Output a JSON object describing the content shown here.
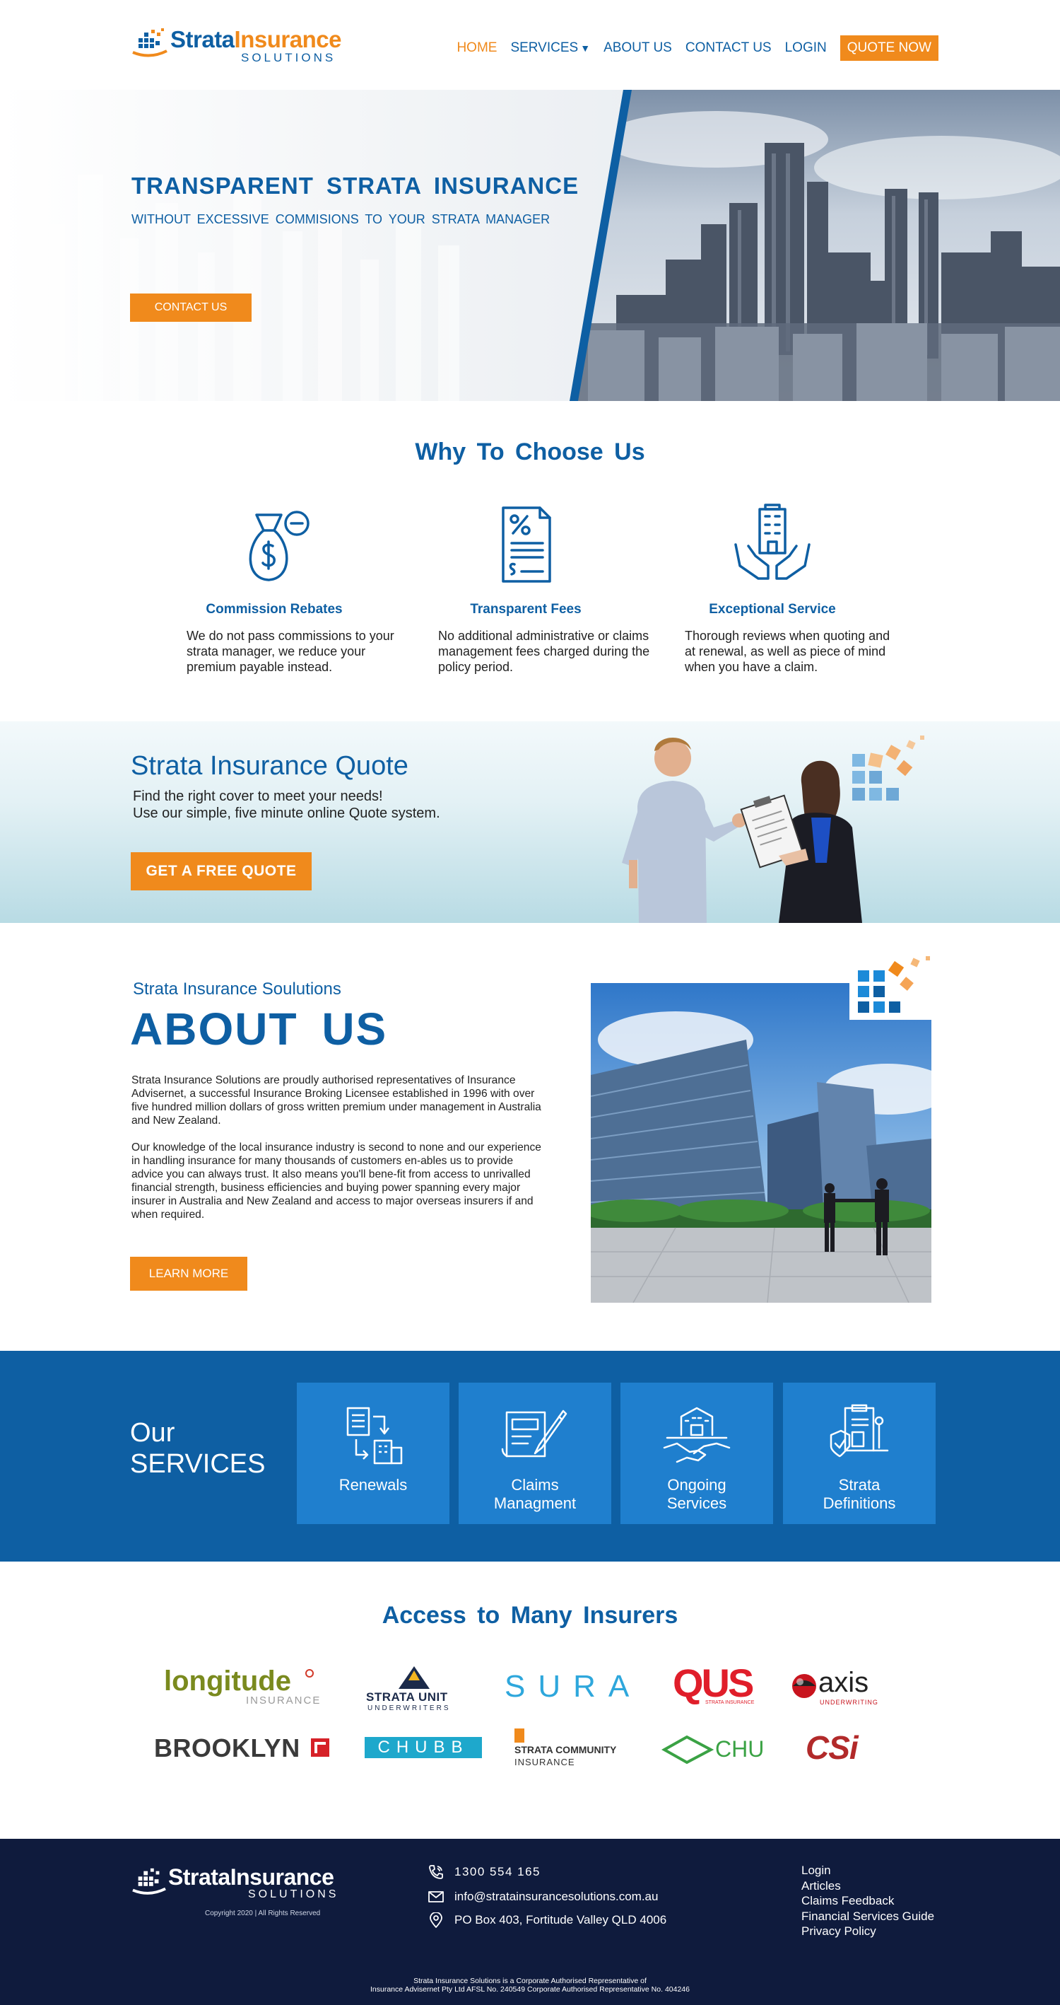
{
  "brand": {
    "name_part1": "Strata",
    "name_part2": "Insurance",
    "sub": "SOLUTIONS",
    "primary": "#0e5fa3",
    "accent": "#f08a1c",
    "footer_bg": "#0f1b3d"
  },
  "nav": {
    "home": "HOME",
    "services": "SERVICES",
    "about": "ABOUT US",
    "contact": "CONTACT US",
    "login": "LOGIN",
    "quote": "QUOTE NOW",
    "caret_icon": "caret-down-icon"
  },
  "hero": {
    "title": "TRANSPARENT STRATA INSURANCE",
    "tagline": "WITHOUT EXCESSIVE COMMISIONS TO YOUR STRATA MANAGER",
    "button": "CONTACT US"
  },
  "why": {
    "title": "Why To Choose Us",
    "features": [
      {
        "title": "Commission Rebates",
        "text": "We do not pass commissions to your strata manager, we reduce your premium payable instead.",
        "icon": "money-bag-icon"
      },
      {
        "title": "Transparent Fees",
        "text": "No additional administrative or claims management fees charged during the policy period.",
        "icon": "document-percent-icon"
      },
      {
        "title": "Exceptional Service",
        "text": "Thorough reviews when quoting and at renewal, as well as piece of mind when you have a claim.",
        "icon": "hands-building-icon"
      }
    ]
  },
  "quote": {
    "title": "Strata Insurance Quote",
    "line1": "Find the right cover to meet your needs!",
    "line2": "Use our simple, five minute online Quote system.",
    "button": "GET A FREE QUOTE"
  },
  "about": {
    "subtitle": "Strata Insurance Soulutions",
    "title": "ABOUT US",
    "p1": "Strata Insurance Solutions are proudly authorised representatives of Insurance Advisernet, a successful Insurance Broking Licensee established in 1996 with over five hundred million dollars of gross written premium under management in Australia and New Zealand.",
    "p2": "Our knowledge of the local insurance industry is second to none and our experience in handling insurance for many thousands of customers en-ables us to provide advice you can always trust. It also means you'll bene-fit from access to unrivalled financial strength, business efficiencies and buying power spanning every major insurer in Australia and New Zealand and access to major overseas insurers if and when required.",
    "button": "LEARN MORE"
  },
  "services": {
    "label1": "Our",
    "label2": "SERVICES",
    "items": [
      {
        "line1": "Renewals",
        "line2": "",
        "icon": "renewal-documents-icon"
      },
      {
        "line1": "Claims",
        "line2": "Managment",
        "icon": "claims-pen-icon"
      },
      {
        "line1": "Ongoing",
        "line2": "Services",
        "icon": "handshake-building-icon"
      },
      {
        "line1": "Strata",
        "line2": "Definitions",
        "icon": "shield-document-icon"
      }
    ]
  },
  "insurers": {
    "title": "Access to Many Insurers",
    "logos": [
      "longitude",
      "INSURANCE",
      "STRATA UNIT",
      "UNDERWRITERS",
      "SURA",
      "QUS",
      "STRATA INSURANCE",
      "axis",
      "UNDERWRITING",
      "BROOKLYN",
      "CHUBB",
      "STRATA COMMUNITY",
      "INSURANCE",
      "CHU",
      "CSi"
    ]
  },
  "footer": {
    "copyright": "Copyright 2020 | All Rights Reserved",
    "phone": "1300 554 165",
    "email": "info@stratainsurancesolutions.com.au",
    "address": "PO Box 403, Fortitude Valley QLD 4006",
    "links": [
      "Login",
      "Articles",
      "Claims Feedback",
      "Financial Services Guide",
      "Privacy Policy"
    ],
    "legal1": "Strata Insurance Solutions is a Corporate Authorised Representative of",
    "legal2": "Insurance Advisernet Pty Ltd AFSL No. 240549 Corporate Authorised Representative No. 404246"
  }
}
